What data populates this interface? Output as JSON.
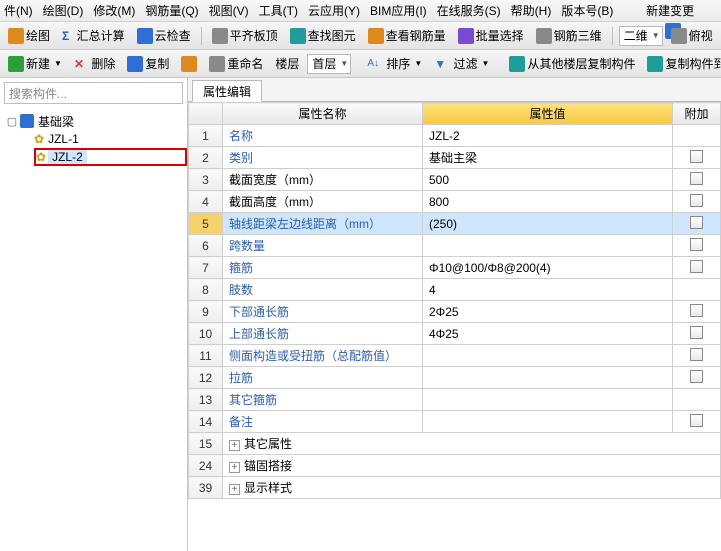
{
  "menu": {
    "items": [
      "件(N)",
      "绘图(D)",
      "修改(M)",
      "钢筋量(Q)",
      "视图(V)",
      "工具(T)",
      "云应用(Y)",
      "BIM应用(I)",
      "在线服务(S)",
      "帮助(H)",
      "版本号(B)"
    ],
    "new_change": "新建变更"
  },
  "tb1": {
    "draw": "绘图",
    "sum": "汇总计算",
    "cloud": "云检查",
    "level": "平齐板顶",
    "findel": "查找图元",
    "viewrebar": "查看钢筋量",
    "batchsel": "批量选择",
    "rebar3d": "钢筋三维",
    "view2d": "二维",
    "birdview": "俯视"
  },
  "tb2": {
    "newc": "新建",
    "del": "删除",
    "copy": "复制",
    "rename": "重命名",
    "floor": "楼层",
    "first": "首层",
    "sort": "排序",
    "filter": "过滤",
    "copyfrom": "从其他楼层复制构件",
    "copyto": "复制构件到其他楼层"
  },
  "search": {
    "placeholder": "搜索构件..."
  },
  "tree": {
    "root": "基础梁",
    "c1": "JZL-1",
    "c2": "JZL-2"
  },
  "tab": {
    "title": "属性编辑"
  },
  "headers": {
    "name": "属性名称",
    "value": "属性值",
    "extra": "附加"
  },
  "rows": [
    {
      "n": "1",
      "name": "名称",
      "val": "JZL-2",
      "blue": true,
      "chk": false
    },
    {
      "n": "2",
      "name": "类别",
      "val": "基础主梁",
      "blue": true,
      "chk": true
    },
    {
      "n": "3",
      "name": "截面宽度（mm）",
      "val": "500",
      "blue": false,
      "chk": true
    },
    {
      "n": "4",
      "name": "截面高度（mm）",
      "val": "800",
      "blue": false,
      "chk": true
    },
    {
      "n": "5",
      "name": "轴线距梁左边线距离（mm）",
      "val": "(250)",
      "blue": true,
      "chk": true,
      "sel": true
    },
    {
      "n": "6",
      "name": "跨数量",
      "val": "",
      "blue": true,
      "chk": true
    },
    {
      "n": "7",
      "name": "箍筋",
      "val": "Φ10@100/Φ8@200(4)",
      "blue": true,
      "chk": true
    },
    {
      "n": "8",
      "name": "肢数",
      "val": "4",
      "blue": true,
      "chk": false
    },
    {
      "n": "9",
      "name": "下部通长筋",
      "val": "2Φ25",
      "blue": true,
      "chk": true
    },
    {
      "n": "10",
      "name": "上部通长筋",
      "val": "4Φ25",
      "blue": true,
      "chk": true
    },
    {
      "n": "11",
      "name": "侧面构造或受扭筋（总配筋值）",
      "val": "",
      "blue": true,
      "chk": true
    },
    {
      "n": "12",
      "name": "拉筋",
      "val": "",
      "blue": true,
      "chk": true
    },
    {
      "n": "13",
      "name": "其它箍筋",
      "val": "",
      "blue": true,
      "chk": false
    },
    {
      "n": "14",
      "name": "备注",
      "val": "",
      "blue": true,
      "chk": true
    }
  ],
  "grows": [
    {
      "n": "15",
      "name": "其它属性"
    },
    {
      "n": "24",
      "name": "锚固搭接"
    },
    {
      "n": "39",
      "name": "显示样式"
    }
  ]
}
